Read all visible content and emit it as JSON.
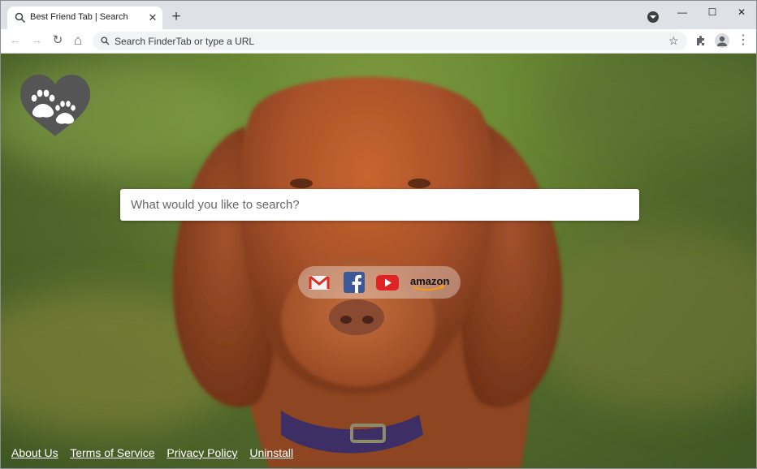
{
  "tab": {
    "title": "Best Friend Tab | Search",
    "close": "✕"
  },
  "newtab": "+",
  "window_controls": {
    "minimize": "—",
    "maximize": "☐",
    "close": "✕"
  },
  "toolbar": {
    "back": "←",
    "forward": "→",
    "reload": "↻",
    "home": "⌂",
    "omnibox_placeholder": "Search FinderTab or type a URL",
    "bookmark": "☆",
    "extensions": "✦",
    "menu": "⋮"
  },
  "search": {
    "placeholder": "What would you like to search?"
  },
  "shortcuts": [
    {
      "name": "gmail",
      "icon": "gmail-icon"
    },
    {
      "name": "facebook",
      "icon": "facebook-icon"
    },
    {
      "name": "youtube",
      "icon": "youtube-icon"
    },
    {
      "name": "amazon",
      "label": "amazon",
      "icon": "amazon-icon"
    }
  ],
  "footer": {
    "about": "About Us",
    "terms": "Terms of Service",
    "privacy": "Privacy Policy",
    "uninstall": "Uninstall"
  },
  "colors": {
    "background_green": "#6b8a35",
    "dog_brown": "#b0552a",
    "logo_gray": "#555555",
    "youtube_red": "#e02323",
    "facebook_blue": "#3b5998"
  }
}
